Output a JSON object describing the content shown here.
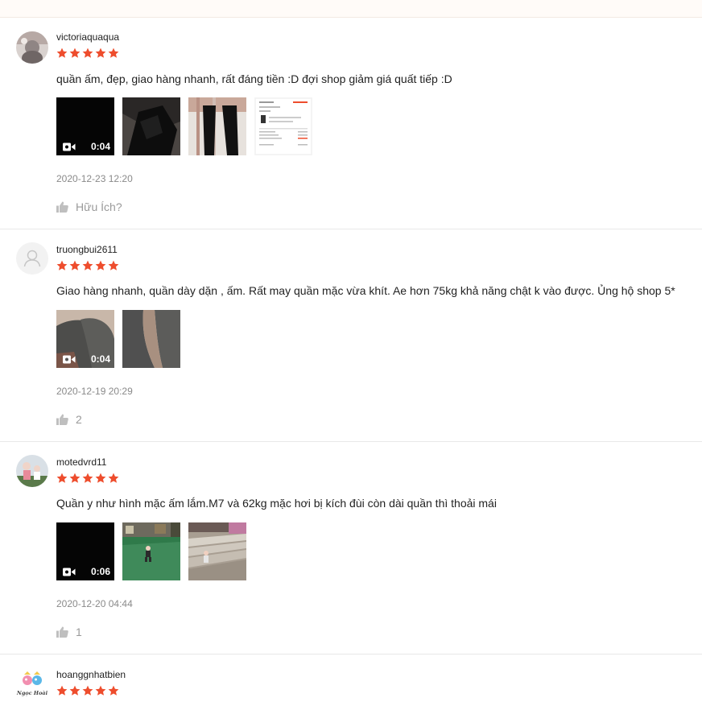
{
  "reviews": [
    {
      "username": "victoriaquaqua",
      "rating": 5,
      "comment": "quần ấm, đẹp, giao hàng nhanh, rất đáng tiền :D đợi shop giảm giá quất tiếp :D",
      "video_duration": "0:04",
      "date": "2020-12-23 12:20",
      "like_label": "Hữu Ích?"
    },
    {
      "username": "truongbui2611",
      "rating": 5,
      "comment": "Giao hàng nhanh, quần dày dặn , ấm. Rất may quần mặc vừa khít. Ae hơn 75kg khả năng chật k vào được. Ủng hộ shop 5*",
      "video_duration": "0:04",
      "date": "2020-12-19 20:29",
      "like_label": "2"
    },
    {
      "username": "motedvrd11",
      "rating": 5,
      "comment": "Quần y như hình mặc ấm lắm.M7 và 62kg mặc hơi bị kích đùi còn dài quần thì thoải mái",
      "video_duration": "0:06",
      "date": "2020-12-20 04:44",
      "like_label": "1"
    },
    {
      "username": "hoanggnhatbien",
      "rating": 5,
      "avatar_text": "Ngọc Hoài"
    }
  ],
  "colors": {
    "star": "#ee4d2d",
    "muted": "#8a8a8a",
    "divider": "#e8e8e8"
  },
  "icons": [
    "star-icon",
    "video-camera-icon",
    "thumbs-up-icon",
    "user-placeholder-icon"
  ]
}
